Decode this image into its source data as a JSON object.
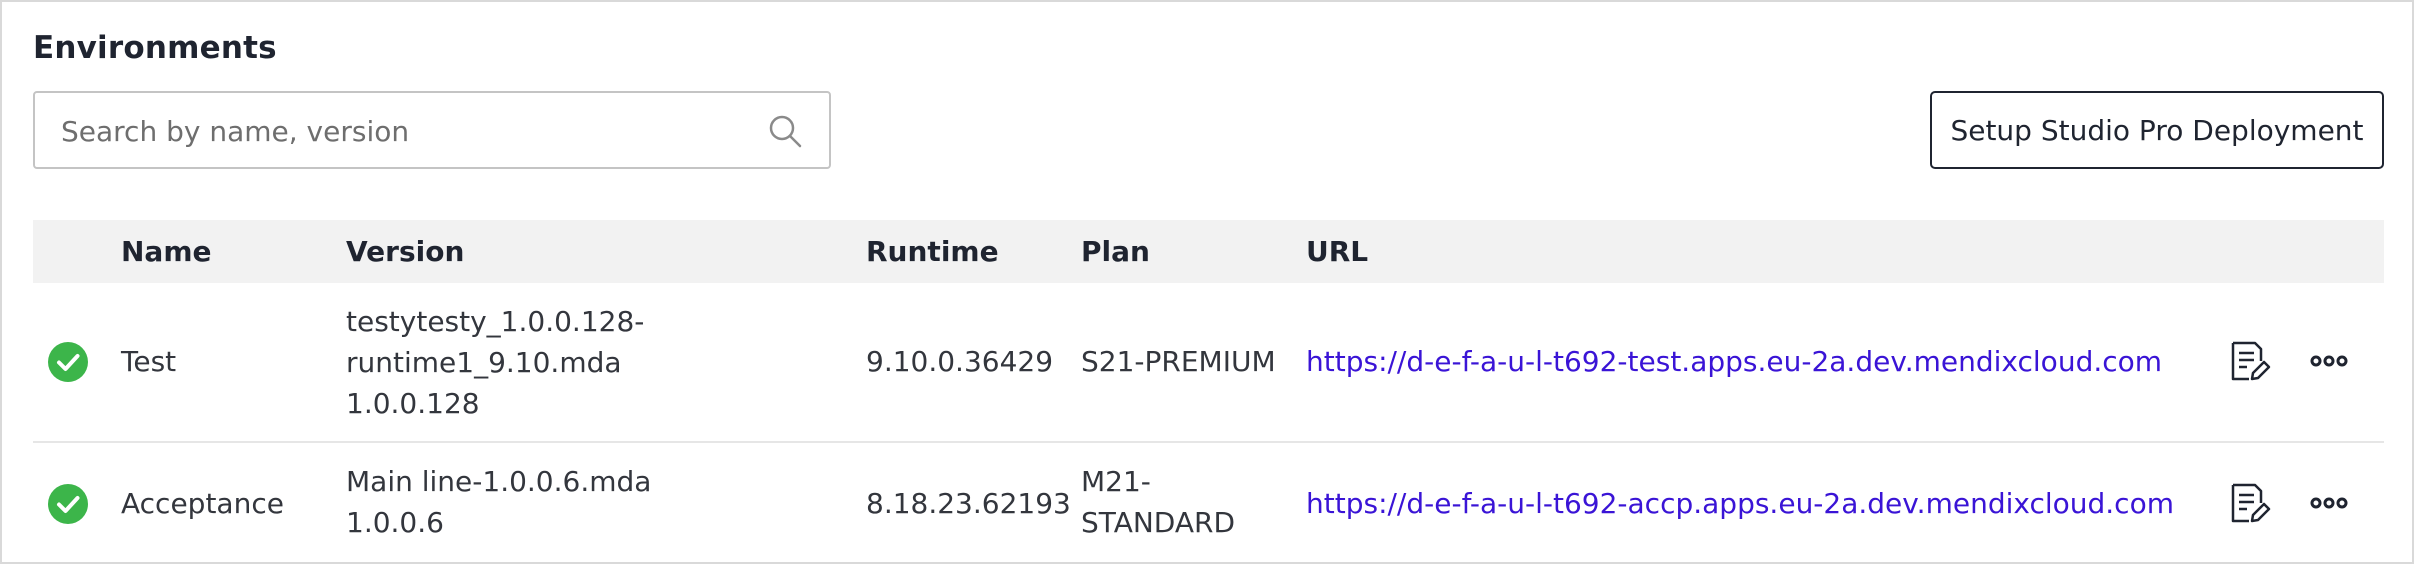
{
  "section": {
    "title": "Environments"
  },
  "search": {
    "placeholder": "Search by name, version",
    "value": ""
  },
  "toolbar": {
    "setup_label": "Setup Studio Pro Deployment"
  },
  "table": {
    "columns": [
      "Name",
      "Version",
      "Runtime",
      "Plan",
      "URL"
    ],
    "rows": [
      {
        "status": "success",
        "name": "Test",
        "version_lines": [
          "testytesty_1.0.0.128-",
          "runtime1_9.10.mda",
          "1.0.0.128"
        ],
        "runtime": "9.10.0.36429",
        "plan_lines": [
          "S21-PREMIUM"
        ],
        "url": "https://d-e-f-a-u-l-t692-test.apps.eu-2a.dev.mendixcloud.com"
      },
      {
        "status": "success",
        "name": "Acceptance",
        "version_lines": [
          "Main line-1.0.0.6.mda",
          "1.0.0.6"
        ],
        "runtime": "8.18.23.62193",
        "plan_lines": [
          "M21-",
          "STANDARD"
        ],
        "url": "https://d-e-f-a-u-l-t692-accp.apps.eu-2a.dev.mendixcloud.com"
      }
    ]
  },
  "icons": {
    "status": "check-circle-icon",
    "details": "document-edit-icon",
    "more": "more-horizontal-icon"
  },
  "colors": {
    "success": "#3cb54a",
    "link": "#3a14d6",
    "header_bg": "#f2f2f2"
  }
}
